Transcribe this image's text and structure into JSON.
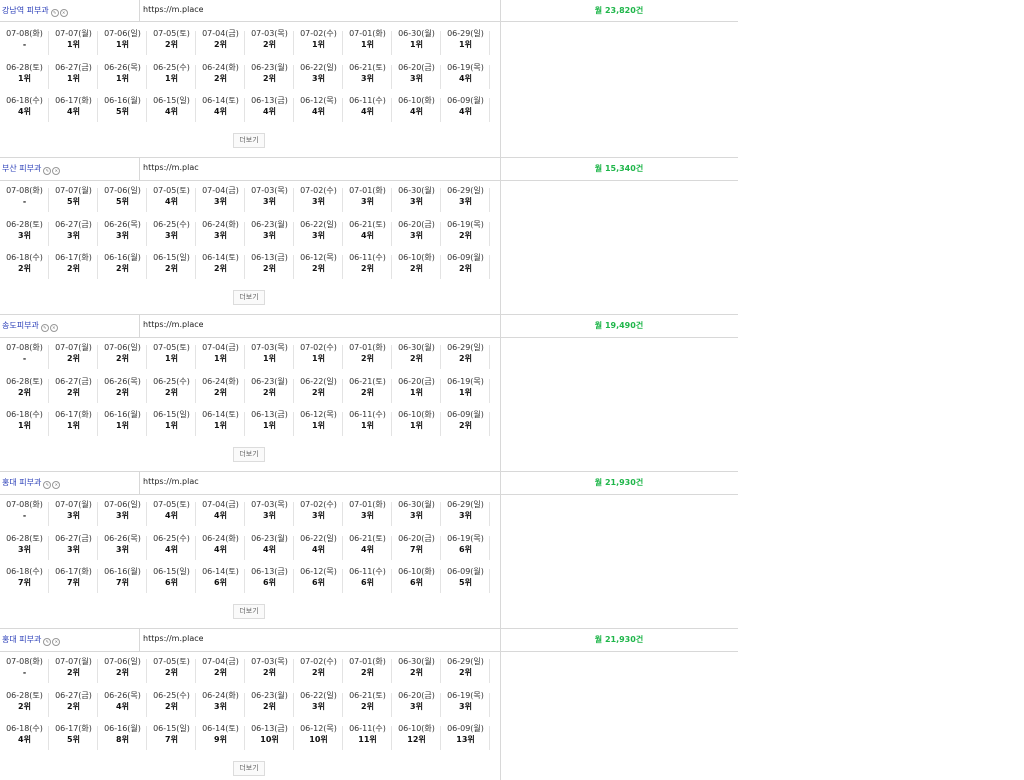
{
  "blocks": [
    {
      "keyword": "강남역 피부과",
      "url": "https://m.place",
      "volume": "월 23,820건",
      "more_label": "더보기",
      "days": [
        {
          "date": "07-08(화)",
          "rank": "-"
        },
        {
          "date": "07-07(월)",
          "rank": "1위"
        },
        {
          "date": "07-06(일)",
          "rank": "1위"
        },
        {
          "date": "07-05(토)",
          "rank": "2위"
        },
        {
          "date": "07-04(금)",
          "rank": "2위"
        },
        {
          "date": "07-03(목)",
          "rank": "2위"
        },
        {
          "date": "07-02(수)",
          "rank": "1위"
        },
        {
          "date": "07-01(화)",
          "rank": "1위"
        },
        {
          "date": "06-30(월)",
          "rank": "1위"
        },
        {
          "date": "06-29(일)",
          "rank": "1위"
        },
        {
          "date": "06-28(토)",
          "rank": "1위"
        },
        {
          "date": "06-27(금)",
          "rank": "1위"
        },
        {
          "date": "06-26(목)",
          "rank": "1위"
        },
        {
          "date": "06-25(수)",
          "rank": "1위"
        },
        {
          "date": "06-24(화)",
          "rank": "2위"
        },
        {
          "date": "06-23(월)",
          "rank": "2위"
        },
        {
          "date": "06-22(일)",
          "rank": "3위"
        },
        {
          "date": "06-21(토)",
          "rank": "3위"
        },
        {
          "date": "06-20(금)",
          "rank": "3위"
        },
        {
          "date": "06-19(목)",
          "rank": "4위"
        },
        {
          "date": "06-18(수)",
          "rank": "4위"
        },
        {
          "date": "06-17(화)",
          "rank": "4위"
        },
        {
          "date": "06-16(월)",
          "rank": "5위"
        },
        {
          "date": "06-15(일)",
          "rank": "4위"
        },
        {
          "date": "06-14(토)",
          "rank": "4위"
        },
        {
          "date": "06-13(금)",
          "rank": "4위"
        },
        {
          "date": "06-12(목)",
          "rank": "4위"
        },
        {
          "date": "06-11(수)",
          "rank": "4위"
        },
        {
          "date": "06-10(화)",
          "rank": "4위"
        },
        {
          "date": "06-09(월)",
          "rank": "4위"
        }
      ]
    },
    {
      "keyword": "부산 피부과",
      "url": "https://m.plac",
      "volume": "월 15,340건",
      "more_label": "더보기",
      "days": [
        {
          "date": "07-08(화)",
          "rank": "-"
        },
        {
          "date": "07-07(월)",
          "rank": "5위"
        },
        {
          "date": "07-06(일)",
          "rank": "5위"
        },
        {
          "date": "07-05(토)",
          "rank": "4위"
        },
        {
          "date": "07-04(금)",
          "rank": "3위"
        },
        {
          "date": "07-03(목)",
          "rank": "3위"
        },
        {
          "date": "07-02(수)",
          "rank": "3위"
        },
        {
          "date": "07-01(화)",
          "rank": "3위"
        },
        {
          "date": "06-30(월)",
          "rank": "3위"
        },
        {
          "date": "06-29(일)",
          "rank": "3위"
        },
        {
          "date": "06-28(토)",
          "rank": "3위"
        },
        {
          "date": "06-27(금)",
          "rank": "3위"
        },
        {
          "date": "06-26(목)",
          "rank": "3위"
        },
        {
          "date": "06-25(수)",
          "rank": "3위"
        },
        {
          "date": "06-24(화)",
          "rank": "3위"
        },
        {
          "date": "06-23(월)",
          "rank": "3위"
        },
        {
          "date": "06-22(일)",
          "rank": "3위"
        },
        {
          "date": "06-21(토)",
          "rank": "4위"
        },
        {
          "date": "06-20(금)",
          "rank": "3위"
        },
        {
          "date": "06-19(목)",
          "rank": "2위"
        },
        {
          "date": "06-18(수)",
          "rank": "2위"
        },
        {
          "date": "06-17(화)",
          "rank": "2위"
        },
        {
          "date": "06-16(월)",
          "rank": "2위"
        },
        {
          "date": "06-15(일)",
          "rank": "2위"
        },
        {
          "date": "06-14(토)",
          "rank": "2위"
        },
        {
          "date": "06-13(금)",
          "rank": "2위"
        },
        {
          "date": "06-12(목)",
          "rank": "2위"
        },
        {
          "date": "06-11(수)",
          "rank": "2위"
        },
        {
          "date": "06-10(화)",
          "rank": "2위"
        },
        {
          "date": "06-09(월)",
          "rank": "2위"
        }
      ]
    },
    {
      "keyword": "송도피부과",
      "url": "https://m.place.",
      "volume": "월 19,490건",
      "more_label": "더보기",
      "days": [
        {
          "date": "07-08(화)",
          "rank": "-"
        },
        {
          "date": "07-07(월)",
          "rank": "2위"
        },
        {
          "date": "07-06(일)",
          "rank": "2위"
        },
        {
          "date": "07-05(토)",
          "rank": "1위"
        },
        {
          "date": "07-04(금)",
          "rank": "1위"
        },
        {
          "date": "07-03(목)",
          "rank": "1위"
        },
        {
          "date": "07-02(수)",
          "rank": "1위"
        },
        {
          "date": "07-01(화)",
          "rank": "2위"
        },
        {
          "date": "06-30(월)",
          "rank": "2위"
        },
        {
          "date": "06-29(일)",
          "rank": "2위"
        },
        {
          "date": "06-28(토)",
          "rank": "2위"
        },
        {
          "date": "06-27(금)",
          "rank": "2위"
        },
        {
          "date": "06-26(목)",
          "rank": "2위"
        },
        {
          "date": "06-25(수)",
          "rank": "2위"
        },
        {
          "date": "06-24(화)",
          "rank": "2위"
        },
        {
          "date": "06-23(월)",
          "rank": "2위"
        },
        {
          "date": "06-22(일)",
          "rank": "2위"
        },
        {
          "date": "06-21(토)",
          "rank": "2위"
        },
        {
          "date": "06-20(금)",
          "rank": "1위"
        },
        {
          "date": "06-19(목)",
          "rank": "1위"
        },
        {
          "date": "06-18(수)",
          "rank": "1위"
        },
        {
          "date": "06-17(화)",
          "rank": "1위"
        },
        {
          "date": "06-16(월)",
          "rank": "1위"
        },
        {
          "date": "06-15(일)",
          "rank": "1위"
        },
        {
          "date": "06-14(토)",
          "rank": "1위"
        },
        {
          "date": "06-13(금)",
          "rank": "1위"
        },
        {
          "date": "06-12(목)",
          "rank": "1위"
        },
        {
          "date": "06-11(수)",
          "rank": "1위"
        },
        {
          "date": "06-10(화)",
          "rank": "1위"
        },
        {
          "date": "06-09(월)",
          "rank": "2위"
        }
      ]
    },
    {
      "keyword": "홍대 피부과",
      "url": "https://m.plac",
      "volume": "월 21,930건",
      "more_label": "더보기",
      "days": [
        {
          "date": "07-08(화)",
          "rank": "-"
        },
        {
          "date": "07-07(월)",
          "rank": "3위"
        },
        {
          "date": "07-06(일)",
          "rank": "3위"
        },
        {
          "date": "07-05(토)",
          "rank": "4위"
        },
        {
          "date": "07-04(금)",
          "rank": "4위"
        },
        {
          "date": "07-03(목)",
          "rank": "3위"
        },
        {
          "date": "07-02(수)",
          "rank": "3위"
        },
        {
          "date": "07-01(화)",
          "rank": "3위"
        },
        {
          "date": "06-30(월)",
          "rank": "3위"
        },
        {
          "date": "06-29(일)",
          "rank": "3위"
        },
        {
          "date": "06-28(토)",
          "rank": "3위"
        },
        {
          "date": "06-27(금)",
          "rank": "3위"
        },
        {
          "date": "06-26(목)",
          "rank": "3위"
        },
        {
          "date": "06-25(수)",
          "rank": "4위"
        },
        {
          "date": "06-24(화)",
          "rank": "4위"
        },
        {
          "date": "06-23(월)",
          "rank": "4위"
        },
        {
          "date": "06-22(일)",
          "rank": "4위"
        },
        {
          "date": "06-21(토)",
          "rank": "4위"
        },
        {
          "date": "06-20(금)",
          "rank": "7위"
        },
        {
          "date": "06-19(목)",
          "rank": "6위"
        },
        {
          "date": "06-18(수)",
          "rank": "7위"
        },
        {
          "date": "06-17(화)",
          "rank": "7위"
        },
        {
          "date": "06-16(월)",
          "rank": "7위"
        },
        {
          "date": "06-15(일)",
          "rank": "6위"
        },
        {
          "date": "06-14(토)",
          "rank": "6위"
        },
        {
          "date": "06-13(금)",
          "rank": "6위"
        },
        {
          "date": "06-12(목)",
          "rank": "6위"
        },
        {
          "date": "06-11(수)",
          "rank": "6위"
        },
        {
          "date": "06-10(화)",
          "rank": "6위"
        },
        {
          "date": "06-09(월)",
          "rank": "5위"
        }
      ]
    },
    {
      "keyword": "홍대 피부과",
      "url": "https://m.place.",
      "volume": "월 21,930건",
      "more_label": "더보기",
      "days": [
        {
          "date": "07-08(화)",
          "rank": "-"
        },
        {
          "date": "07-07(월)",
          "rank": "2위"
        },
        {
          "date": "07-06(일)",
          "rank": "2위"
        },
        {
          "date": "07-05(토)",
          "rank": "2위"
        },
        {
          "date": "07-04(금)",
          "rank": "2위"
        },
        {
          "date": "07-03(목)",
          "rank": "2위"
        },
        {
          "date": "07-02(수)",
          "rank": "2위"
        },
        {
          "date": "07-01(화)",
          "rank": "2위"
        },
        {
          "date": "06-30(월)",
          "rank": "2위"
        },
        {
          "date": "06-29(일)",
          "rank": "2위"
        },
        {
          "date": "06-28(토)",
          "rank": "2위"
        },
        {
          "date": "06-27(금)",
          "rank": "2위"
        },
        {
          "date": "06-26(목)",
          "rank": "4위"
        },
        {
          "date": "06-25(수)",
          "rank": "2위"
        },
        {
          "date": "06-24(화)",
          "rank": "3위"
        },
        {
          "date": "06-23(월)",
          "rank": "2위"
        },
        {
          "date": "06-22(일)",
          "rank": "3위"
        },
        {
          "date": "06-21(토)",
          "rank": "2위"
        },
        {
          "date": "06-20(금)",
          "rank": "3위"
        },
        {
          "date": "06-19(목)",
          "rank": "3위"
        },
        {
          "date": "06-18(수)",
          "rank": "4위"
        },
        {
          "date": "06-17(화)",
          "rank": "5위"
        },
        {
          "date": "06-16(월)",
          "rank": "8위"
        },
        {
          "date": "06-15(일)",
          "rank": "7위"
        },
        {
          "date": "06-14(토)",
          "rank": "9위"
        },
        {
          "date": "06-13(금)",
          "rank": "10위"
        },
        {
          "date": "06-12(목)",
          "rank": "10위"
        },
        {
          "date": "06-11(수)",
          "rank": "11위"
        },
        {
          "date": "06-10(화)",
          "rank": "12위"
        },
        {
          "date": "06-09(월)",
          "rank": "13위"
        }
      ]
    }
  ]
}
